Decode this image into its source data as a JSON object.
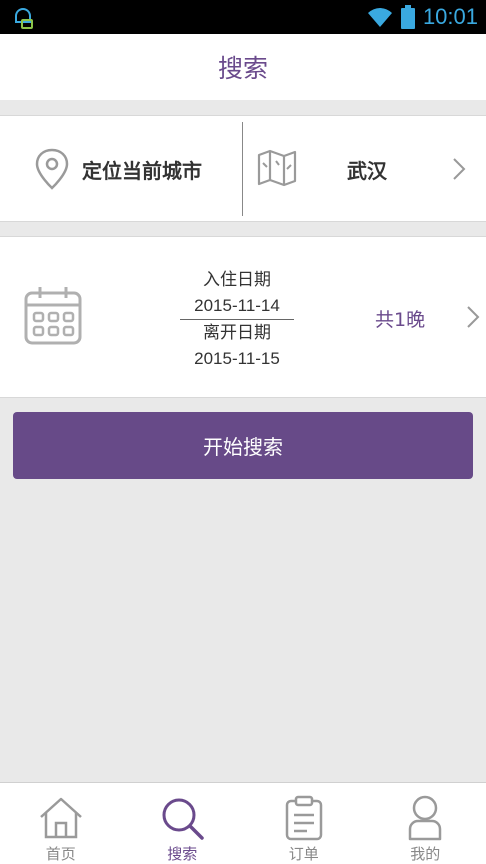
{
  "status_bar": {
    "time": "10:01"
  },
  "header": {
    "title": "搜索"
  },
  "location": {
    "locate_label": "定位当前城市",
    "city": "武汉"
  },
  "dates": {
    "checkin_label": "入住日期",
    "checkin_date": "2015-11-14",
    "checkout_label": "离开日期",
    "checkout_date": "2015-11-15",
    "nights": "共1晚"
  },
  "search_button": {
    "label": "开始搜索"
  },
  "bottom_nav": {
    "items": [
      {
        "label": "首页",
        "icon": "home-icon",
        "active": false
      },
      {
        "label": "搜索",
        "icon": "search-icon",
        "active": true
      },
      {
        "label": "订单",
        "icon": "clipboard-icon",
        "active": false
      },
      {
        "label": "我的",
        "icon": "user-icon",
        "active": false
      }
    ]
  },
  "colors": {
    "accent": "#6a4a8c",
    "button": "#674a88",
    "background": "#e9e9e9",
    "status_icon": "#3aa9e0"
  }
}
